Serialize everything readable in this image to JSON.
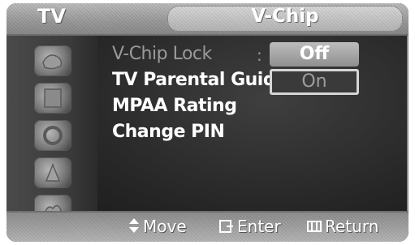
{
  "header": {
    "left_label": "TV",
    "title": "V-Chip"
  },
  "sidebar": {
    "icons": [
      {
        "name": "input-icon"
      },
      {
        "name": "picture-icon"
      },
      {
        "name": "sound-icon"
      },
      {
        "name": "channel-icon"
      },
      {
        "name": "setup-icon"
      }
    ]
  },
  "menu": {
    "items": [
      {
        "label": "V-Chip Lock",
        "state": "dim"
      },
      {
        "label": "TV Parental Guideli",
        "state": "normal"
      },
      {
        "label": "MPAA Rating",
        "state": "normal"
      },
      {
        "label": "Change PIN",
        "state": "normal"
      }
    ],
    "separator": ":",
    "options": {
      "off": "Off",
      "on": "On"
    }
  },
  "footer": {
    "move": "Move",
    "enter": "Enter",
    "return": "Return"
  }
}
